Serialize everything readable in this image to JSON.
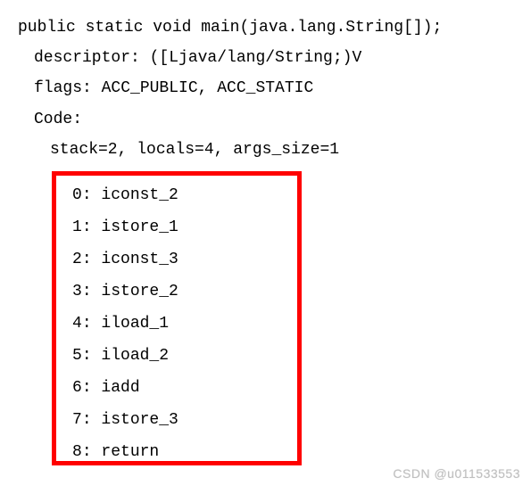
{
  "header": {
    "signature": "public static void main(java.lang.String[]);",
    "descriptor_line": "descriptor: ([Ljava/lang/String;)V",
    "flags_line": "flags: ACC_PUBLIC, ACC_STATIC",
    "code_label": "Code:",
    "stack_line": "stack=2, locals=4, args_size=1"
  },
  "instructions": [
    {
      "offset": "0",
      "op": "iconst_2"
    },
    {
      "offset": "1",
      "op": "istore_1"
    },
    {
      "offset": "2",
      "op": "iconst_3"
    },
    {
      "offset": "3",
      "op": "istore_2"
    },
    {
      "offset": "4",
      "op": "iload_1"
    },
    {
      "offset": "5",
      "op": "iload_2"
    },
    {
      "offset": "6",
      "op": "iadd"
    },
    {
      "offset": "7",
      "op": "istore_3"
    },
    {
      "offset": "8",
      "op": "return"
    }
  ],
  "watermark": "CSDN @u011533553"
}
